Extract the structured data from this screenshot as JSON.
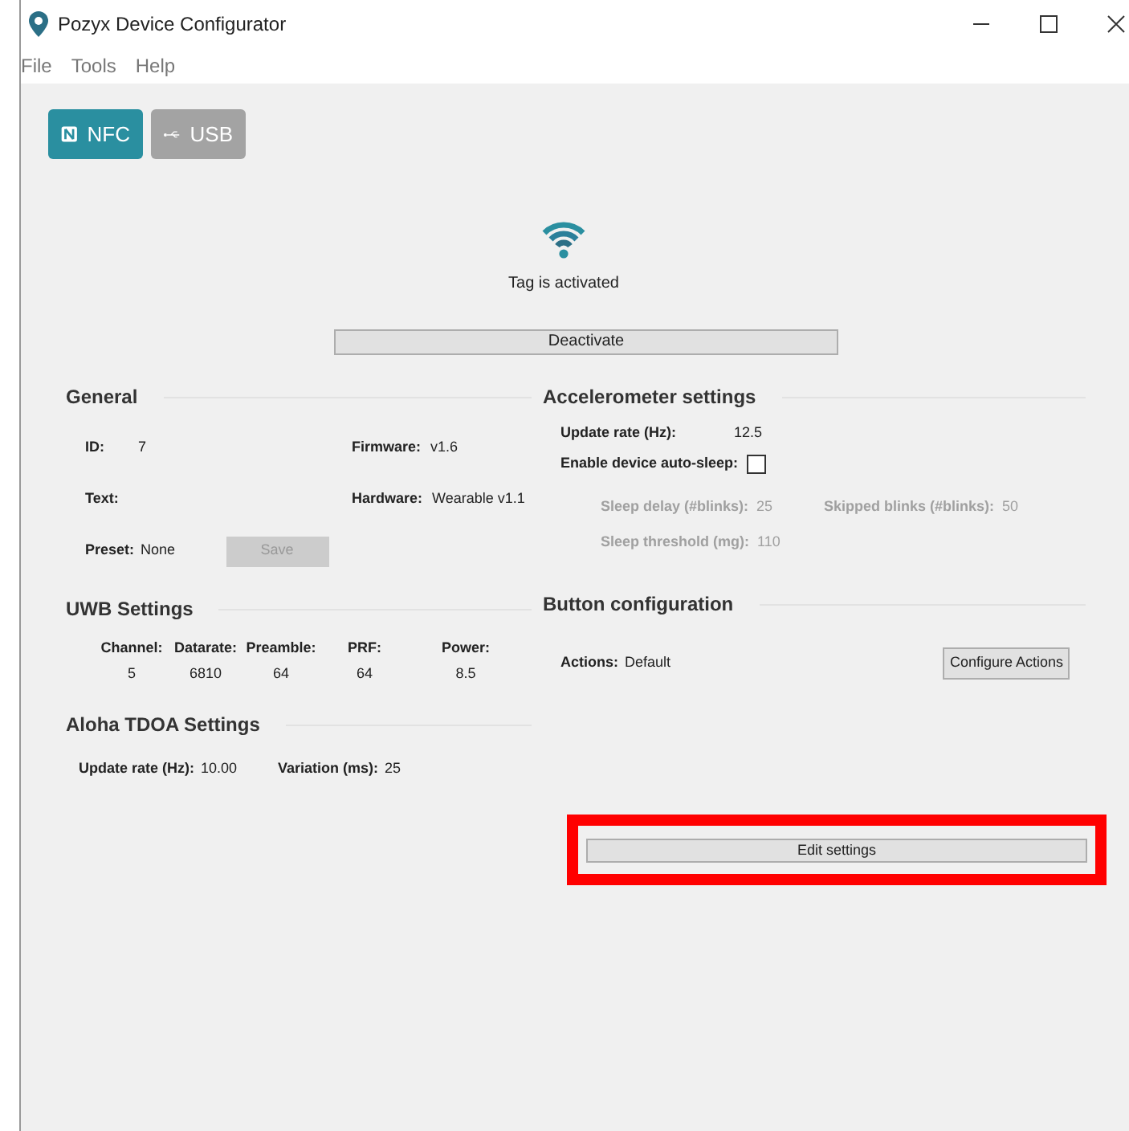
{
  "window": {
    "title": "Pozyx Device Configurator"
  },
  "menu": [
    "File",
    "Tools",
    "Help"
  ],
  "connection_tabs": [
    {
      "label": "NFC",
      "kind": "nfc",
      "selected": true
    },
    {
      "label": "USB",
      "kind": "usb",
      "selected": false
    }
  ],
  "status": {
    "text": "Tag is activated",
    "button": "Deactivate"
  },
  "general": {
    "title": "General",
    "id_label": "ID:",
    "id": "7",
    "firmware_label": "Firmware:",
    "firmware": "v1.6",
    "text_label": "Text:",
    "hardware_label": "Hardware:",
    "hardware": "Wearable v1.1",
    "preset_label": "Preset:",
    "preset": "None",
    "save": {
      "label": "Save",
      "disabled": true
    }
  },
  "uwb": {
    "title": "UWB Settings",
    "columns": [
      {
        "label": "Channel:",
        "value": "5"
      },
      {
        "label": "Datarate:",
        "value": "6810"
      },
      {
        "label": "Preamble:",
        "value": "64"
      },
      {
        "label": "PRF:",
        "value": "64"
      },
      {
        "label": "Power:",
        "value": "8.5"
      }
    ]
  },
  "aloha": {
    "title": "Aloha TDOA Settings",
    "update_label": "Update rate (Hz):",
    "update": "10.00",
    "variation_label": "Variation (ms):",
    "variation": "25"
  },
  "accelerometer": {
    "title": "Accelerometer settings",
    "update_label": "Update rate (Hz):",
    "update": "12.5",
    "autosleep_label": "Enable device auto-sleep:",
    "autosleep": false,
    "sleep_fields": [
      {
        "label": "Sleep delay (#blinks):",
        "value": "25",
        "disabled": true
      },
      {
        "label": "Skipped blinks (#blinks):",
        "value": "50",
        "disabled": true
      },
      {
        "label": "Sleep threshold (mg):",
        "value": "110",
        "disabled": true
      }
    ]
  },
  "button_config": {
    "title": "Button configuration",
    "actions_label": "Actions:",
    "actions": "Default",
    "button": "Configure Actions"
  },
  "edit_button": {
    "label": "Edit settings",
    "highlighted": true
  }
}
